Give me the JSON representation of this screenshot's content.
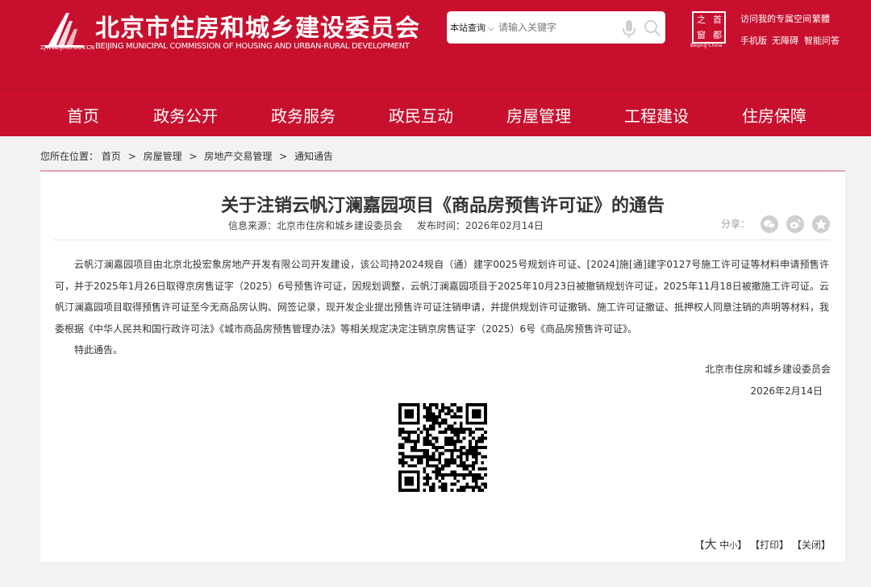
{
  "header": {
    "site_title": "北京市住房和城乡建设委员会",
    "site_subtitle": "BEIJING MUNICIPAL COMMISSION OF HOUSING AND URBAN-RURAL DEVELOPMENT",
    "logo_url_text": "ZJW.BEIJING.GOV.CN",
    "search": {
      "scope_label": "本站查询",
      "placeholder": "请输入关键字"
    },
    "seal": {
      "chars": [
        "首",
        "都",
        "之",
        "窗"
      ],
      "caption": "Beijing·China"
    },
    "links": {
      "my_space": "访问我的专属空间",
      "traditional": "繁體",
      "mobile": "手机版",
      "accessibility": "无障碍",
      "smart_qa": "智能问答"
    },
    "brand_color": "#c8102e"
  },
  "nav": {
    "items": [
      "首页",
      "政务公开",
      "政务服务",
      "政民互动",
      "房屋管理",
      "工程建设",
      "住房保障"
    ]
  },
  "breadcrumb": {
    "prefix": "您所在位置：",
    "items": [
      "首页",
      "房屋管理",
      "房地产交易管理",
      "通知通告"
    ],
    "separator": ">"
  },
  "article": {
    "title": "关于注销云帆汀澜嘉园项目《商品房预售许可证》的通告",
    "source": "信息来源：北京市住房和城乡建设委员会",
    "pubtime": "发布时间：2026年02月14日",
    "share_label": "分享：",
    "share_icons": [
      "wechat-icon",
      "weibo-icon",
      "qzone-icon"
    ],
    "paragraph_1": "云帆汀澜嘉园项目由北京北投宏象房地产开发有限公司开发建设，该公司持2024规自（通）建字0025号规划许可证、[2024]施[通]建字0127号施工许可证等材料申请预售许可，并于2025年1月26日取得京房售证字（2025）6号预售许可证，因规划调整，云帆汀澜嘉园项目于2025年10月23日被撤销规划许可证，2025年11月18日被撤施工许可证。云帆汀澜嘉园项目取得预售许可证至今无商品房认购、网签记录，现开发企业提出预售许可证注销申请，并提供规划许可证撤销、施工许可证撤证、抵押权人同意注销的声明等材料，我委根据《中华人民共和国行政许可法》《城市商品房预售管理办法》等相关规定决定注销京房售证字（2025）6号《商品房预售许可证》。",
    "paragraph_2": "特此通告。",
    "signature_org": "北京市住房和城乡建设委员会",
    "signature_date": "2026年2月14日"
  },
  "tools": {
    "open_bracket": "【",
    "font_large": "大",
    "font_medium": "中",
    "font_small": "小",
    "close_bracket": "】",
    "print": "【打印】",
    "close": "【关闭】"
  }
}
